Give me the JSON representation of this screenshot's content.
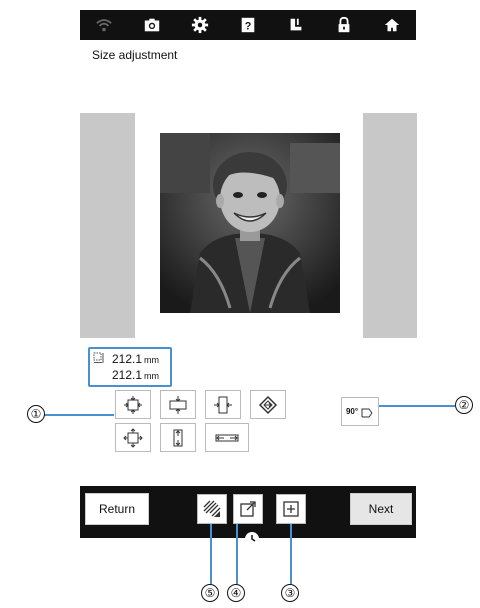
{
  "screen_title": "Size adjustment",
  "topbar": {
    "icons": [
      "wifi-icon",
      "camera-icon",
      "gear-icon",
      "help-icon",
      "presser-foot-icon",
      "lock-icon",
      "home-icon"
    ]
  },
  "size": {
    "width_value": "212.1",
    "height_value": "212.1",
    "unit": "mm"
  },
  "rotate_label": "90°",
  "bottom_bar": {
    "return_label": "Return",
    "next_label": "Next"
  },
  "callouts": {
    "c1": "①",
    "c2": "②",
    "c3": "③",
    "c4": "④",
    "c5": "⑤"
  },
  "colors": {
    "topbar": "#111111",
    "callout_line": "#4a8fd0",
    "preview_bg": "#c8c8c8"
  }
}
